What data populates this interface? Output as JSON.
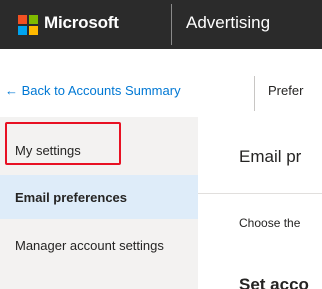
{
  "topbar": {
    "brand": "Microsoft",
    "product": "Advertising",
    "logo_colors": [
      "#f25022",
      "#7fba00",
      "#00a4ef",
      "#ffb900"
    ]
  },
  "subnav": {
    "back_label": "← Back to Accounts Summary",
    "tab_label": "Prefer"
  },
  "sidebar": {
    "items": [
      {
        "label": "My settings",
        "highlighted": true,
        "selected": false
      },
      {
        "label": "Email preferences",
        "selected": true
      },
      {
        "label": "Manager account settings",
        "selected": false
      }
    ]
  },
  "content": {
    "title": "Email pr",
    "description": "Choose the",
    "section_heading": "Set acco"
  },
  "colors": {
    "topbar_bg": "#2b2b2b",
    "link": "#0078d4",
    "sidebar_bg": "#f3f2f1",
    "selected_bg": "#deecf9",
    "highlight": "#e81123"
  }
}
